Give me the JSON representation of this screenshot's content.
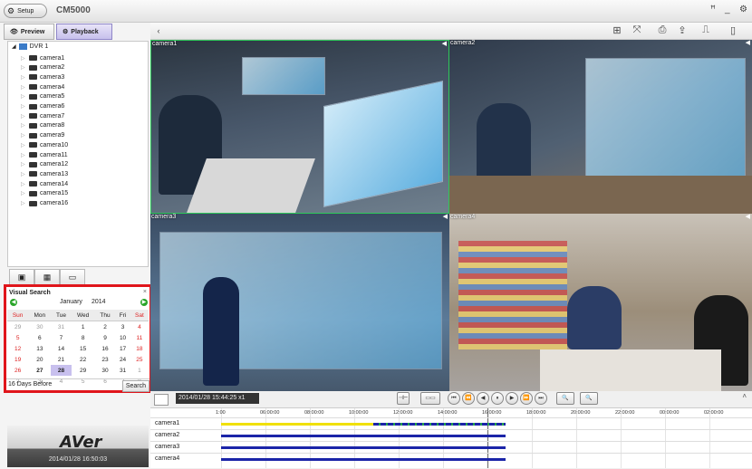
{
  "app": {
    "setup_label": "Setup",
    "title": "CM5000",
    "window_controls": [
      "ꟸ",
      "_",
      "⚙"
    ]
  },
  "modes": {
    "preview": "Preview",
    "playback": "Playback"
  },
  "tree": {
    "root": "DVR 1",
    "cameras": [
      "camera1",
      "camera2",
      "camera3",
      "camera4",
      "camera5",
      "camera6",
      "camera7",
      "camera8",
      "camera9",
      "camera10",
      "camera11",
      "camera12",
      "camera13",
      "camera14",
      "camera15",
      "camera16"
    ]
  },
  "visual_search": {
    "title": "Visual Search",
    "close": "×",
    "month": "January",
    "year": "2014",
    "weekdays": [
      "Sun",
      "Mon",
      "Tue",
      "Wed",
      "Thu",
      "Fri",
      "Sat"
    ],
    "weeks": [
      [
        "29",
        "30",
        "31",
        "1",
        "2",
        "3",
        "4"
      ],
      [
        "5",
        "6",
        "7",
        "8",
        "9",
        "10",
        "11"
      ],
      [
        "12",
        "13",
        "14",
        "15",
        "16",
        "17",
        "18"
      ],
      [
        "19",
        "20",
        "21",
        "22",
        "23",
        "24",
        "25"
      ],
      [
        "26",
        "27",
        "28",
        "29",
        "30",
        "31",
        "1"
      ],
      [
        "2",
        "3",
        "4",
        "5",
        "6",
        "7",
        "8"
      ]
    ],
    "selected_day": "28",
    "footer_text": "16 Days Before",
    "search_button": "Search"
  },
  "logo": {
    "text": "AVer",
    "clock": "2014/01/28 16:50:03"
  },
  "video": {
    "cells": [
      {
        "label": "camera1"
      },
      {
        "label": "camera2"
      },
      {
        "label": "camera3"
      },
      {
        "label": "camera4"
      }
    ]
  },
  "timeline": {
    "timestamp": "2014/01/28 15:44:25 x1",
    "ticks": [
      "1:00",
      "06:00:00",
      "08:00:00",
      "10:00:00",
      "12:00:00",
      "14:00:00",
      "16:00:00",
      "18:00:00",
      "20:00:00",
      "22:00:00",
      "00:00:00",
      "02:00:00"
    ],
    "tracks": [
      {
        "name": "camera1"
      },
      {
        "name": "camera2"
      },
      {
        "name": "camera3"
      },
      {
        "name": "camera4"
      }
    ],
    "colors": {
      "motion": "#f0e000",
      "record": "#1b25a8",
      "alarm": "#27a84a"
    }
  }
}
